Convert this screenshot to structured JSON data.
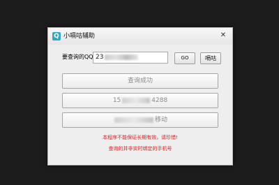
{
  "window": {
    "title": "小嗝咕辅助",
    "app_icon": "app-logo-icon",
    "close_glyph": "✕"
  },
  "query": {
    "label": "要查询的QQ:",
    "value_prefix": "23"
  },
  "buttons": {
    "go_label": "GO",
    "xiao_label": "嗝咕"
  },
  "results": {
    "status": "查询成功",
    "phone_prefix": "15",
    "phone_suffix": "4288",
    "carrier_suffix": "移动"
  },
  "notices": {
    "line1": "本程序不能保证长期有效，请珍惜!",
    "line2": "查询的并非实时绑定的手机号"
  },
  "colors": {
    "notice": "#e21d1d",
    "app_icon": "#2fa8c8"
  }
}
